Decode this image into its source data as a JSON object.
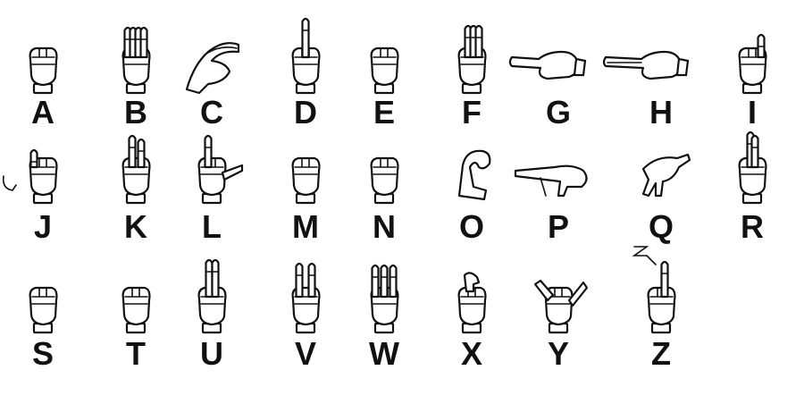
{
  "chart_data": {
    "type": "table",
    "rows": [
      [
        "A",
        "B",
        "C",
        "D",
        "E",
        "F",
        "G",
        "H",
        "I"
      ],
      [
        "J",
        "K",
        "L",
        "M",
        "N",
        "O",
        "P",
        "Q",
        "R"
      ],
      [
        "S",
        "T",
        "U",
        "V",
        "W",
        "X",
        "Y",
        "Z"
      ]
    ],
    "z_motion_mark": "Z"
  }
}
